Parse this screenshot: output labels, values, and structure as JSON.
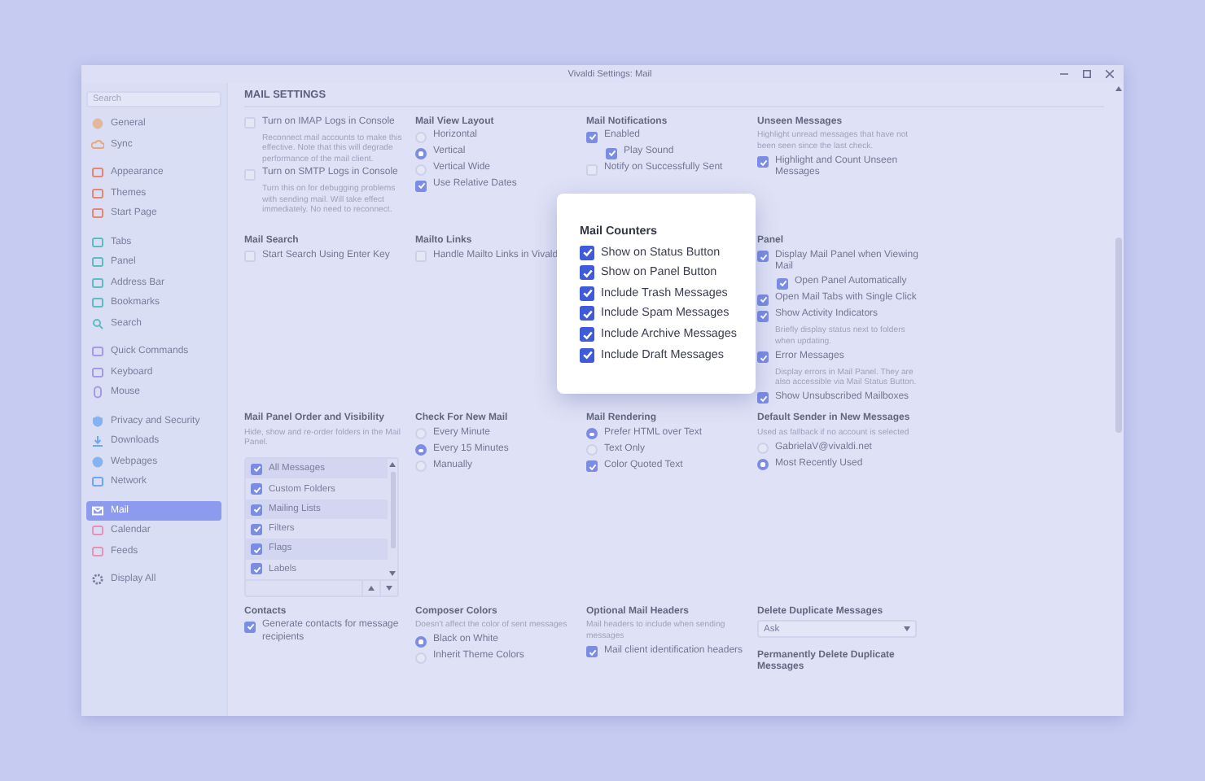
{
  "window": {
    "title": "Vivaldi Settings: Mail"
  },
  "sidebar": {
    "search": {
      "placeholder": "Search"
    },
    "groups": [
      {
        "items": [
          {
            "label": "General",
            "selected": false
          },
          {
            "label": "Sync",
            "selected": false
          }
        ]
      },
      {
        "items": [
          {
            "label": "Appearance",
            "selected": false
          },
          {
            "label": "Themes",
            "selected": false
          },
          {
            "label": "Start Page",
            "selected": false
          }
        ]
      },
      {
        "items": [
          {
            "label": "Tabs",
            "selected": false
          },
          {
            "label": "Panel",
            "selected": false
          },
          {
            "label": "Address Bar",
            "selected": false
          },
          {
            "label": "Bookmarks",
            "selected": false
          },
          {
            "label": "Search",
            "selected": false
          }
        ]
      },
      {
        "items": [
          {
            "label": "Quick Commands",
            "selected": false
          },
          {
            "label": "Keyboard",
            "selected": false
          },
          {
            "label": "Mouse",
            "selected": false
          }
        ]
      },
      {
        "items": [
          {
            "label": "Privacy and Security",
            "selected": false
          },
          {
            "label": "Downloads",
            "selected": false
          },
          {
            "label": "Webpages",
            "selected": false
          },
          {
            "label": "Network",
            "selected": false
          }
        ]
      },
      {
        "items": [
          {
            "label": "Mail",
            "selected": true
          },
          {
            "label": "Calendar",
            "selected": false
          },
          {
            "label": "Feeds",
            "selected": false
          }
        ]
      },
      {
        "items": [
          {
            "label": "Display All",
            "selected": false
          }
        ]
      }
    ]
  },
  "content": {
    "heading": "MAIL SETTINGS",
    "rows": [
      {
        "sections": [
          {
            "kind": "plain",
            "items": [
              {
                "kind": "checkbox",
                "label": "Turn on IMAP Logs in Console",
                "checked": false
              },
              {
                "kind": "note",
                "text": "Reconnect mail accounts to make this effective. Note that this will degrade performance of the mail client."
              },
              {
                "kind": "checkbox",
                "label": "Turn on SMTP Logs in Console",
                "checked": false
              },
              {
                "kind": "note",
                "text": "Turn this on for debugging problems with sending mail. Will take effect immediately. No need to reconnect."
              }
            ]
          },
          {
            "kind": "plain",
            "title": "Mail View Layout",
            "items": [
              {
                "kind": "radio",
                "label": "Horizontal",
                "selected": false
              },
              {
                "kind": "radio",
                "label": "Vertical",
                "selected": true
              },
              {
                "kind": "radio",
                "label": "Vertical Wide",
                "selected": false
              },
              {
                "kind": "checkbox",
                "label": "Use Relative Dates",
                "checked": true
              }
            ]
          },
          {
            "kind": "plain",
            "title": "Mail Notifications",
            "items": [
              {
                "kind": "checkbox",
                "label": "Enabled",
                "checked": true,
                "children": [
                  {
                    "kind": "checkbox",
                    "label": "Play Sound",
                    "checked": true
                  }
                ]
              },
              {
                "kind": "checkbox",
                "label": "Notify on Successfully Sent",
                "checked": false
              }
            ]
          },
          {
            "kind": "plain",
            "title": "Unseen Messages",
            "description": "Highlight unread messages that have not been seen since the last check.",
            "items": [
              {
                "kind": "checkbox",
                "label": "Highlight and Count Unseen Messages",
                "checked": true
              }
            ]
          }
        ]
      },
      {
        "sections": [
          {
            "kind": "plain",
            "title": "Mail Search",
            "items": [
              {
                "kind": "checkbox",
                "label": "Start Search Using Enter Key",
                "checked": false
              }
            ]
          },
          {
            "kind": "plain",
            "title": "Mailto Links",
            "items": [
              {
                "kind": "checkbox",
                "label": "Handle Mailto Links in Vivald",
                "checked": false
              }
            ]
          },
          {
            "kind": "popup",
            "title": "Mail Counters",
            "items": [
              {
                "kind": "checkbox",
                "label": "Show on Status Button",
                "checked": true
              },
              {
                "kind": "checkbox",
                "label": "Show on Panel Button",
                "checked": true
              },
              {
                "kind": "checkbox",
                "label": "Include Trash Messages",
                "checked": true
              },
              {
                "kind": "checkbox",
                "label": "Include Spam Messages",
                "checked": true
              },
              {
                "kind": "checkbox",
                "label": "Include Archive Messages",
                "checked": true
              },
              {
                "kind": "checkbox",
                "label": "Include Draft Messages",
                "checked": true
              }
            ]
          },
          {
            "kind": "plain",
            "title": "Panel",
            "items": [
              {
                "kind": "checkbox",
                "label": "Display Mail Panel when Viewing Mail",
                "checked": true,
                "children": [
                  {
                    "kind": "checkbox",
                    "label": "Open Panel Automatically",
                    "checked": true
                  }
                ]
              },
              {
                "kind": "checkbox",
                "label": "Open Mail Tabs with Single Click",
                "checked": true
              },
              {
                "kind": "checkbox",
                "label": "Show Activity Indicators",
                "checked": true,
                "note": "Briefly display status next to folders when updating."
              },
              {
                "kind": "checkbox",
                "label": "Error Messages",
                "checked": true,
                "note": "Display errors in Mail Panel. They are also accessible via Mail Status Button."
              },
              {
                "kind": "checkbox",
                "label": "Show Unsubscribed Mailboxes",
                "checked": true
              }
            ]
          }
        ]
      },
      {
        "sections": [
          {
            "kind": "plain",
            "title": "Mail Panel Order and Visibility",
            "description": "Hide, show and re-order folders in the Mail Panel.",
            "items": [
              {
                "kind": "folder_list",
                "folders": [
                  {
                    "label": "All Messages",
                    "checked": true
                  },
                  {
                    "label": "Custom Folders",
                    "checked": true
                  },
                  {
                    "label": "Mailing Lists",
                    "checked": true
                  },
                  {
                    "label": "Filters",
                    "checked": true
                  },
                  {
                    "label": "Flags",
                    "checked": true
                  },
                  {
                    "label": "Labels",
                    "checked": true
                  }
                ]
              }
            ]
          },
          {
            "kind": "plain",
            "title": "Check For New Mail",
            "items": [
              {
                "kind": "radio",
                "label": "Every Minute",
                "selected": false
              },
              {
                "kind": "radio",
                "label": "Every 15 Minutes",
                "selected": true
              },
              {
                "kind": "radio",
                "label": "Manually",
                "selected": false
              }
            ]
          },
          {
            "kind": "plain",
            "title": "Mail Rendering",
            "items": [
              {
                "kind": "radio",
                "label": "Prefer HTML over Text",
                "selected": true
              },
              {
                "kind": "radio",
                "label": "Text Only",
                "selected": false
              },
              {
                "kind": "checkbox",
                "label": "Color Quoted Text",
                "checked": true
              }
            ]
          },
          {
            "kind": "plain",
            "title": "Default Sender in New Messages",
            "description": "Used as fallback if no account is selected",
            "items": [
              {
                "kind": "radio",
                "label": "GabrielaV@vivaldi.net",
                "selected": false
              },
              {
                "kind": "radio",
                "label": "Most Recently Used",
                "selected": true
              }
            ]
          }
        ]
      },
      {
        "sections": [
          {
            "kind": "plain",
            "title": "Contacts",
            "items": [
              {
                "kind": "checkbox",
                "label": "Generate contacts for message recipients",
                "checked": true
              }
            ]
          },
          {
            "kind": "plain",
            "title": "Composer Colors",
            "description": "Doesn't affect the color of sent messages",
            "items": [
              {
                "kind": "radio",
                "label": "Black on White",
                "selected": true
              },
              {
                "kind": "radio",
                "label": "Inherit Theme Colors",
                "selected": false
              }
            ]
          },
          {
            "kind": "plain",
            "title": "Optional Mail Headers",
            "description": "Mail headers to include when sending messages",
            "items": [
              {
                "kind": "checkbox",
                "label": "Mail client identification headers",
                "checked": true
              }
            ]
          },
          {
            "kind": "plain",
            "title": "Delete Duplicate Messages",
            "items": [
              {
                "kind": "select",
                "value": "Ask"
              },
              {
                "kind": "subheading",
                "text": "Permanently Delete Duplicate Messages"
              }
            ]
          }
        ]
      }
    ]
  }
}
